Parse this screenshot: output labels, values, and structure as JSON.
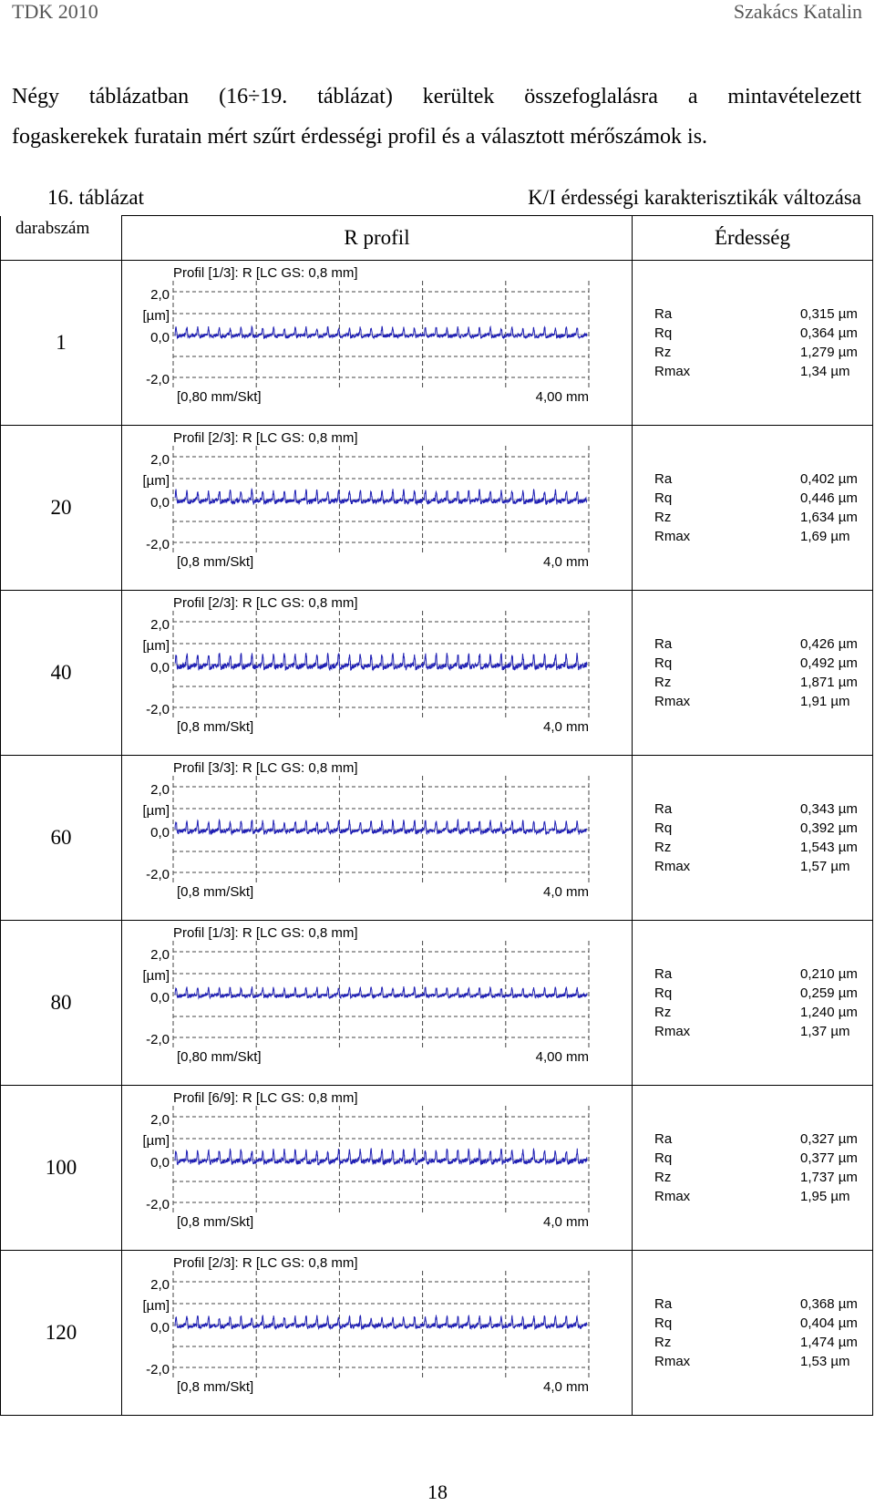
{
  "header": {
    "left": "TDK 2010",
    "right": "Szakács Katalin"
  },
  "paragraph": {
    "line1": "Négy táblázatban (16÷19. táblázat) kerültek összefoglalásra a mintavételezett",
    "line2": "fogaskerekek furatain mért szűrt érdességi profil és a választott mérőszámok is."
  },
  "caption": {
    "number": "16. táblázat",
    "title": "K/I érdességi karakterisztikák változása"
  },
  "table_headers": {
    "count": "darabszám",
    "profile": "R profil",
    "roughness": "Érdesség"
  },
  "profile_labels": {
    "ymax": "2,0",
    "unit": "[µm]",
    "yzero": "0,0",
    "ymin": "-2,0"
  },
  "param_names": [
    "Ra",
    "Rq",
    "Rz",
    "Rmax"
  ],
  "colors": {
    "trace": "#1f1fb4",
    "grid": "#444444",
    "text": "#000000"
  },
  "rows": [
    {
      "count": "1",
      "profile_title": "Profil [1/3]: R [LC GS: 0,8 mm]",
      "scale": "[0,80 mm/Skt]",
      "length": "4,00 mm",
      "params": [
        {
          "value": "0,315 µm"
        },
        {
          "value": "0,364 µm"
        },
        {
          "value": "1,279 µm"
        },
        {
          "value": "1,34   µm"
        }
      ]
    },
    {
      "count": "20",
      "profile_title": "Profil [2/3]: R [LC GS: 0,8 mm]",
      "scale": "[0,8 mm/Skt]",
      "length": "4,0 mm",
      "params": [
        {
          "value": "0,402 µm"
        },
        {
          "value": "0,446 µm"
        },
        {
          "value": "1,634 µm"
        },
        {
          "value": "1,69   µm"
        }
      ]
    },
    {
      "count": "40",
      "profile_title": "Profil [2/3]: R [LC GS: 0,8 mm]",
      "scale": "[0,8 mm/Skt]",
      "length": "4,0 mm",
      "params": [
        {
          "value": "0,426 µm"
        },
        {
          "value": "0,492 µm"
        },
        {
          "value": "1,871 µm"
        },
        {
          "value": "1,91   µm"
        }
      ]
    },
    {
      "count": "60",
      "profile_title": "Profil [3/3]: R [LC GS: 0,8 mm]",
      "scale": "[0,8 mm/Skt]",
      "length": "4,0 mm",
      "params": [
        {
          "value": "0,343 µm"
        },
        {
          "value": "0,392 µm"
        },
        {
          "value": "1,543 µm"
        },
        {
          "value": "1,57   µm"
        }
      ]
    },
    {
      "count": "80",
      "profile_title": "Profil [1/3]: R [LC GS: 0,8 mm]",
      "scale": "[0,80 mm/Skt]",
      "length": "4,00 mm",
      "params": [
        {
          "value": "0,210 µm"
        },
        {
          "value": "0,259 µm"
        },
        {
          "value": "1,240 µm"
        },
        {
          "value": "1,37   µm"
        }
      ]
    },
    {
      "count": "100",
      "profile_title": "Profil [6/9]: R [LC GS: 0,8 mm]",
      "scale": "[0,8 mm/Skt]",
      "length": "4,0 mm",
      "params": [
        {
          "value": "0,327 µm"
        },
        {
          "value": "0,377 µm"
        },
        {
          "value": "1,737 µm"
        },
        {
          "value": "1,95   µm"
        }
      ]
    },
    {
      "count": "120",
      "profile_title": "Profil [2/3]: R [LC GS: 0,8 mm]",
      "scale": "[0,8 mm/Skt]",
      "length": "4,0 mm",
      "params": [
        {
          "value": "0,368 µm"
        },
        {
          "value": "0,404 µm"
        },
        {
          "value": "1,474 µm"
        },
        {
          "value": "1,53   µm"
        }
      ]
    }
  ],
  "page_number": "18"
}
